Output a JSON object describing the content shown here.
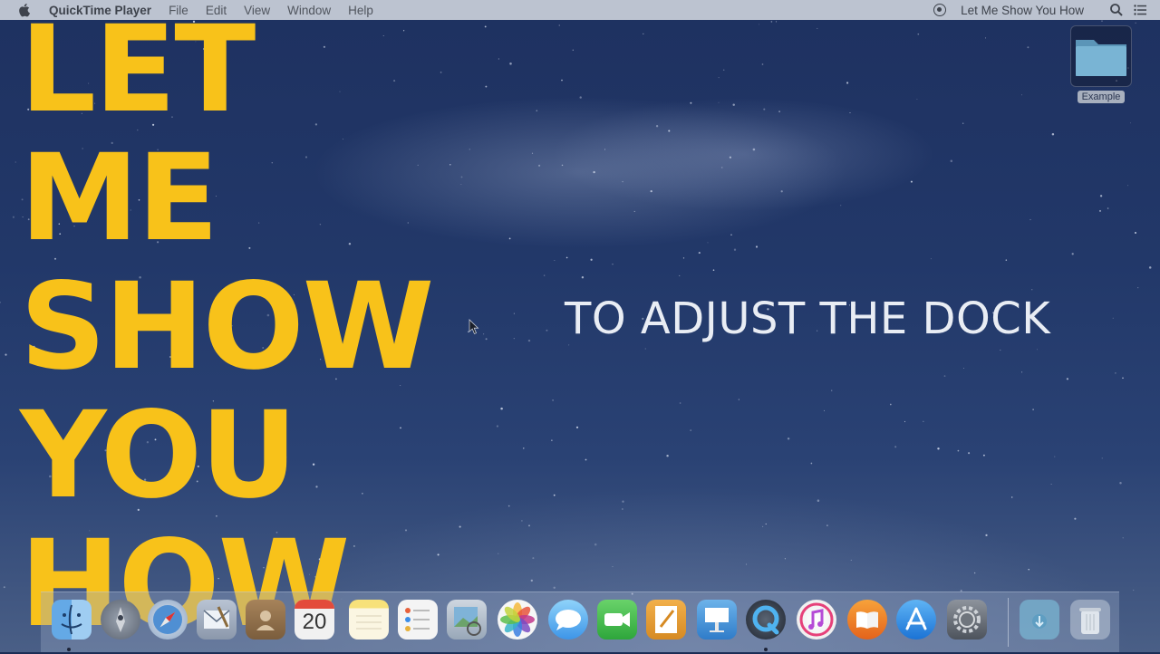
{
  "menubar": {
    "app_name": "QuickTime Player",
    "menus": [
      "File",
      "Edit",
      "View",
      "Window",
      "Help"
    ],
    "right_title": "Let Me Show You How"
  },
  "overlay": {
    "title_lines": [
      "LET",
      "ME",
      "SHOW",
      "YOU",
      "HOW"
    ],
    "subtitle": "TO ADJUST THE DOCK"
  },
  "desktop": {
    "folder_label": "Example"
  },
  "dock": {
    "calendar_day": "20",
    "items": [
      "finder-icon",
      "launchpad-icon",
      "safari-icon",
      "mail-icon",
      "contacts-icon",
      "calendar-icon",
      "notes-icon",
      "reminders-icon",
      "preview-icon",
      "photos-icon",
      "messages-icon",
      "facetime-icon",
      "pages-icon",
      "keynote-icon",
      "quicktime-icon",
      "itunes-icon",
      "ibooks-icon",
      "app-store-icon",
      "system-preferences-icon",
      "downloads-folder-icon",
      "trash-icon"
    ]
  },
  "colors": {
    "title_yellow": "#f8c21a",
    "subtitle_white": "#e9edf4",
    "menubar": "#bcc3d0"
  }
}
